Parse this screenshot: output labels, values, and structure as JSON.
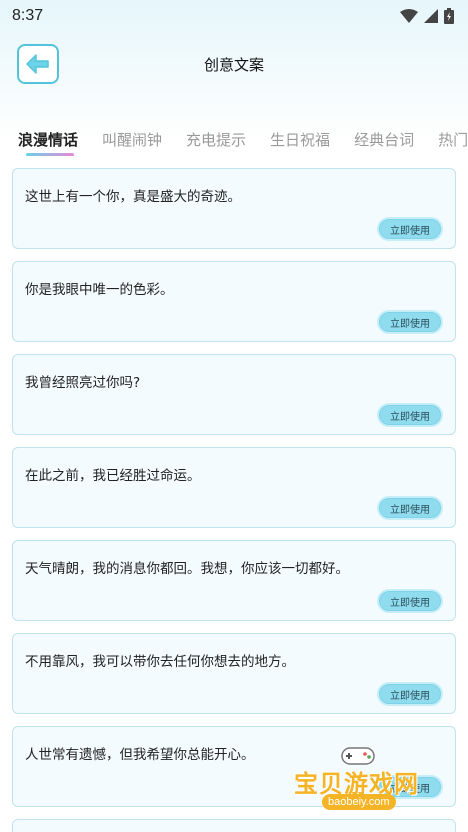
{
  "status": {
    "time": "8:37",
    "icons": [
      "wifi-icon",
      "signal-icon",
      "battery-icon"
    ]
  },
  "header": {
    "back_icon": "back-arrow-icon",
    "title": "创意文案"
  },
  "tabs": [
    {
      "label": "浪漫情话",
      "active": true
    },
    {
      "label": "叫醒闹钟",
      "active": false
    },
    {
      "label": "充电提示",
      "active": false
    },
    {
      "label": "生日祝福",
      "active": false
    },
    {
      "label": "经典台词",
      "active": false
    },
    {
      "label": "热门",
      "active": false
    }
  ],
  "cards": [
    {
      "text": "这世上有一个你，真是盛大的奇迹。",
      "button": "立即使用"
    },
    {
      "text": "你是我眼中唯一的色彩。",
      "button": "立即使用"
    },
    {
      "text": "我曾经照亮过你吗?",
      "button": "立即使用"
    },
    {
      "text": "在此之前，我已经胜过命运。",
      "button": "立即使用"
    },
    {
      "text": "天气晴朗，我的消息你都回。我想，你应该一切都好。",
      "button": "立即使用"
    },
    {
      "text": "不用靠风，我可以带你去任何你想去的地方。",
      "button": "立即使用"
    },
    {
      "text": "人世常有遗憾，但我希望你总能开心。",
      "button": "立即使用"
    }
  ],
  "watermark": {
    "text": "宝贝游戏网",
    "url": "baobeiy.com"
  },
  "colors": {
    "accent": "#53c3db",
    "button_fill": "#8fdcef",
    "card_bg": "#f4fbfe",
    "tab_active_underline_start": "#6ad1e6",
    "tab_active_underline_end": "#e48ad8"
  }
}
